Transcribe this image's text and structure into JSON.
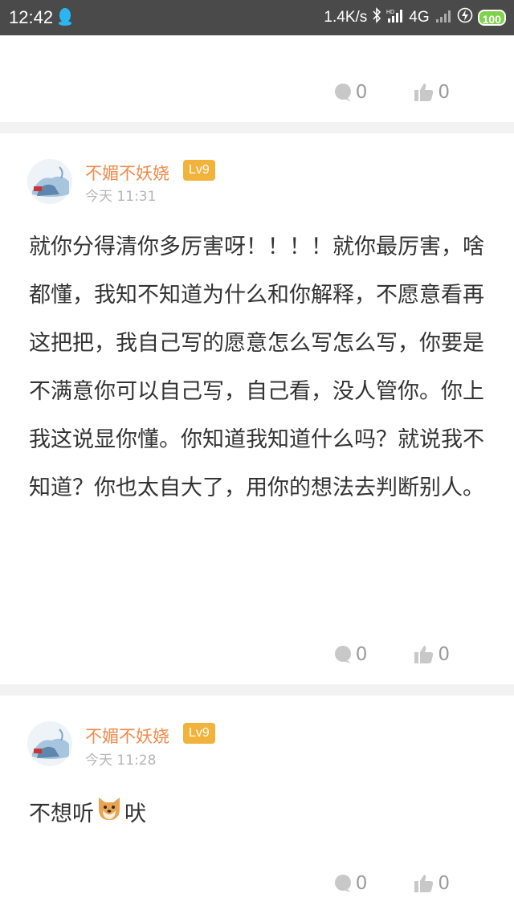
{
  "status_bar": {
    "time": "12:42",
    "network_speed": "1.4K/s",
    "network_type": "4G",
    "battery": "100"
  },
  "prev_post": {
    "comment_count": "0",
    "like_count": "0"
  },
  "comments": [
    {
      "username": "不媚不妖娆",
      "level": "Lv9",
      "time": "今天 11:31",
      "content": "就你分得清你多厉害呀！！！！就你最厉害，啥都懂，我知不知道为什么和你解释，不愿意看再这把把，我自己写的愿意怎么写怎么写，你要是不满意你可以自己写，自己看，没人管你。你上我这说显你懂。你知道我知道什么吗？就说我不知道？你也太自大了，用你的想法去判断别人。",
      "comment_count": "0",
      "like_count": "0"
    },
    {
      "username": "不媚不妖娆",
      "level": "Lv9",
      "time": "今天 11:28",
      "content_before": "不想听",
      "content_after": "吠",
      "emoji": "dog-emoji",
      "comment_count": "0",
      "like_count": "0"
    }
  ],
  "colors": {
    "username": "#f08a4b",
    "level_badge": "#f2b33d",
    "divider": "#f2f2f2",
    "status_bar": "#4a4a4a"
  }
}
